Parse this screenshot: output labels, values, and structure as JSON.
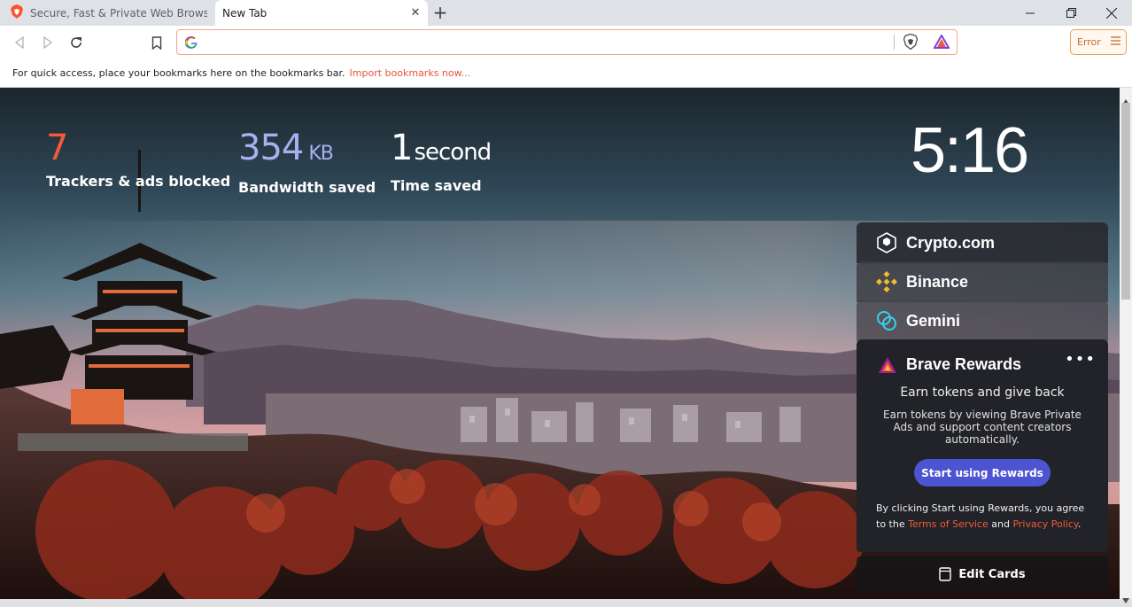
{
  "tabs": [
    {
      "title": "Secure, Fast & Private Web Browser wi",
      "active": false
    },
    {
      "title": "New Tab",
      "active": true
    }
  ],
  "toolbar": {
    "omnibox_value": "",
    "error_label": "Error"
  },
  "bookmarks_bar": {
    "message": "For quick access, place your bookmarks here on the bookmarks bar.",
    "import_link": "Import bookmarks now..."
  },
  "stats": {
    "trackers": {
      "value": "7",
      "label": "Trackers & ads blocked",
      "color": "#f5593f"
    },
    "bandwidth": {
      "value": "354",
      "unit": "KB",
      "label": "Bandwidth saved",
      "color": "#a9b0f2"
    },
    "time": {
      "value": "1",
      "unit": "second",
      "label": "Time saved",
      "color": "#ffffff"
    }
  },
  "clock": "5:16",
  "cards": {
    "crypto_com": "Crypto.com",
    "binance": "Binance",
    "gemini": "Gemini",
    "rewards": {
      "title": "Brave Rewards",
      "more": "•••",
      "subtitle": "Earn tokens and give back",
      "description": "Earn tokens by viewing Brave Private Ads and support content creators automatically.",
      "button": "Start using Rewards",
      "legal_prefix": "By clicking Start using Rewards, you agree to the ",
      "terms": "Terms of Service",
      "and": " and ",
      "privacy": "Privacy Policy",
      "period": "."
    },
    "edit_cards": "Edit Cards"
  },
  "colors": {
    "brave_orange": "#f15a37",
    "rewards_button": "#4c54d2"
  }
}
